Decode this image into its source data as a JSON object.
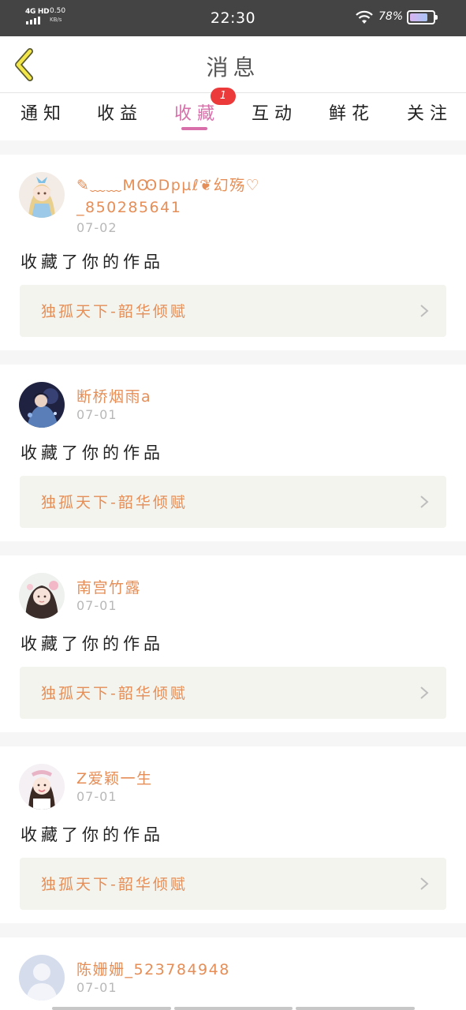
{
  "status_bar": {
    "network": "4G HD",
    "speed_value": "0.50",
    "speed_unit": "KB/s",
    "time": "22:30",
    "battery_percent": "78%"
  },
  "header": {
    "title": "消息",
    "back_icon": "chevron-left-icon"
  },
  "tabs": [
    {
      "label": "通知",
      "active": false
    },
    {
      "label": "收益",
      "active": false
    },
    {
      "label": "收藏",
      "active": true,
      "badge": "1"
    },
    {
      "label": "互动",
      "active": false
    },
    {
      "label": "鲜花",
      "active": false
    },
    {
      "label": "关注",
      "active": false
    }
  ],
  "messages": [
    {
      "user_name": "✎﹏﹏MꙬDpµℓ❦幻殇♡",
      "user_name_line2": "_850285641",
      "date": "07-02",
      "action": "收藏了你的作品",
      "work_title": "独孤天下-韶华倾赋"
    },
    {
      "user_name": "断桥烟雨a",
      "date": "07-01",
      "action": "收藏了你的作品",
      "work_title": "独孤天下-韶华倾赋"
    },
    {
      "user_name": "南宫竹露",
      "date": "07-01",
      "action": "收藏了你的作品",
      "work_title": "独孤天下-韶华倾赋"
    },
    {
      "user_name": "Z爱颖一生",
      "date": "07-01",
      "action": "收藏了你的作品",
      "work_title": "独孤天下-韶华倾赋"
    },
    {
      "user_name": "陈姗姗_523784948",
      "date": "07-01"
    }
  ],
  "colors": {
    "accent_pink": "#d86eaa",
    "name_orange": "#e58e57",
    "badge_red": "#ec3a3a",
    "work_bg": "#f4f4ee"
  }
}
